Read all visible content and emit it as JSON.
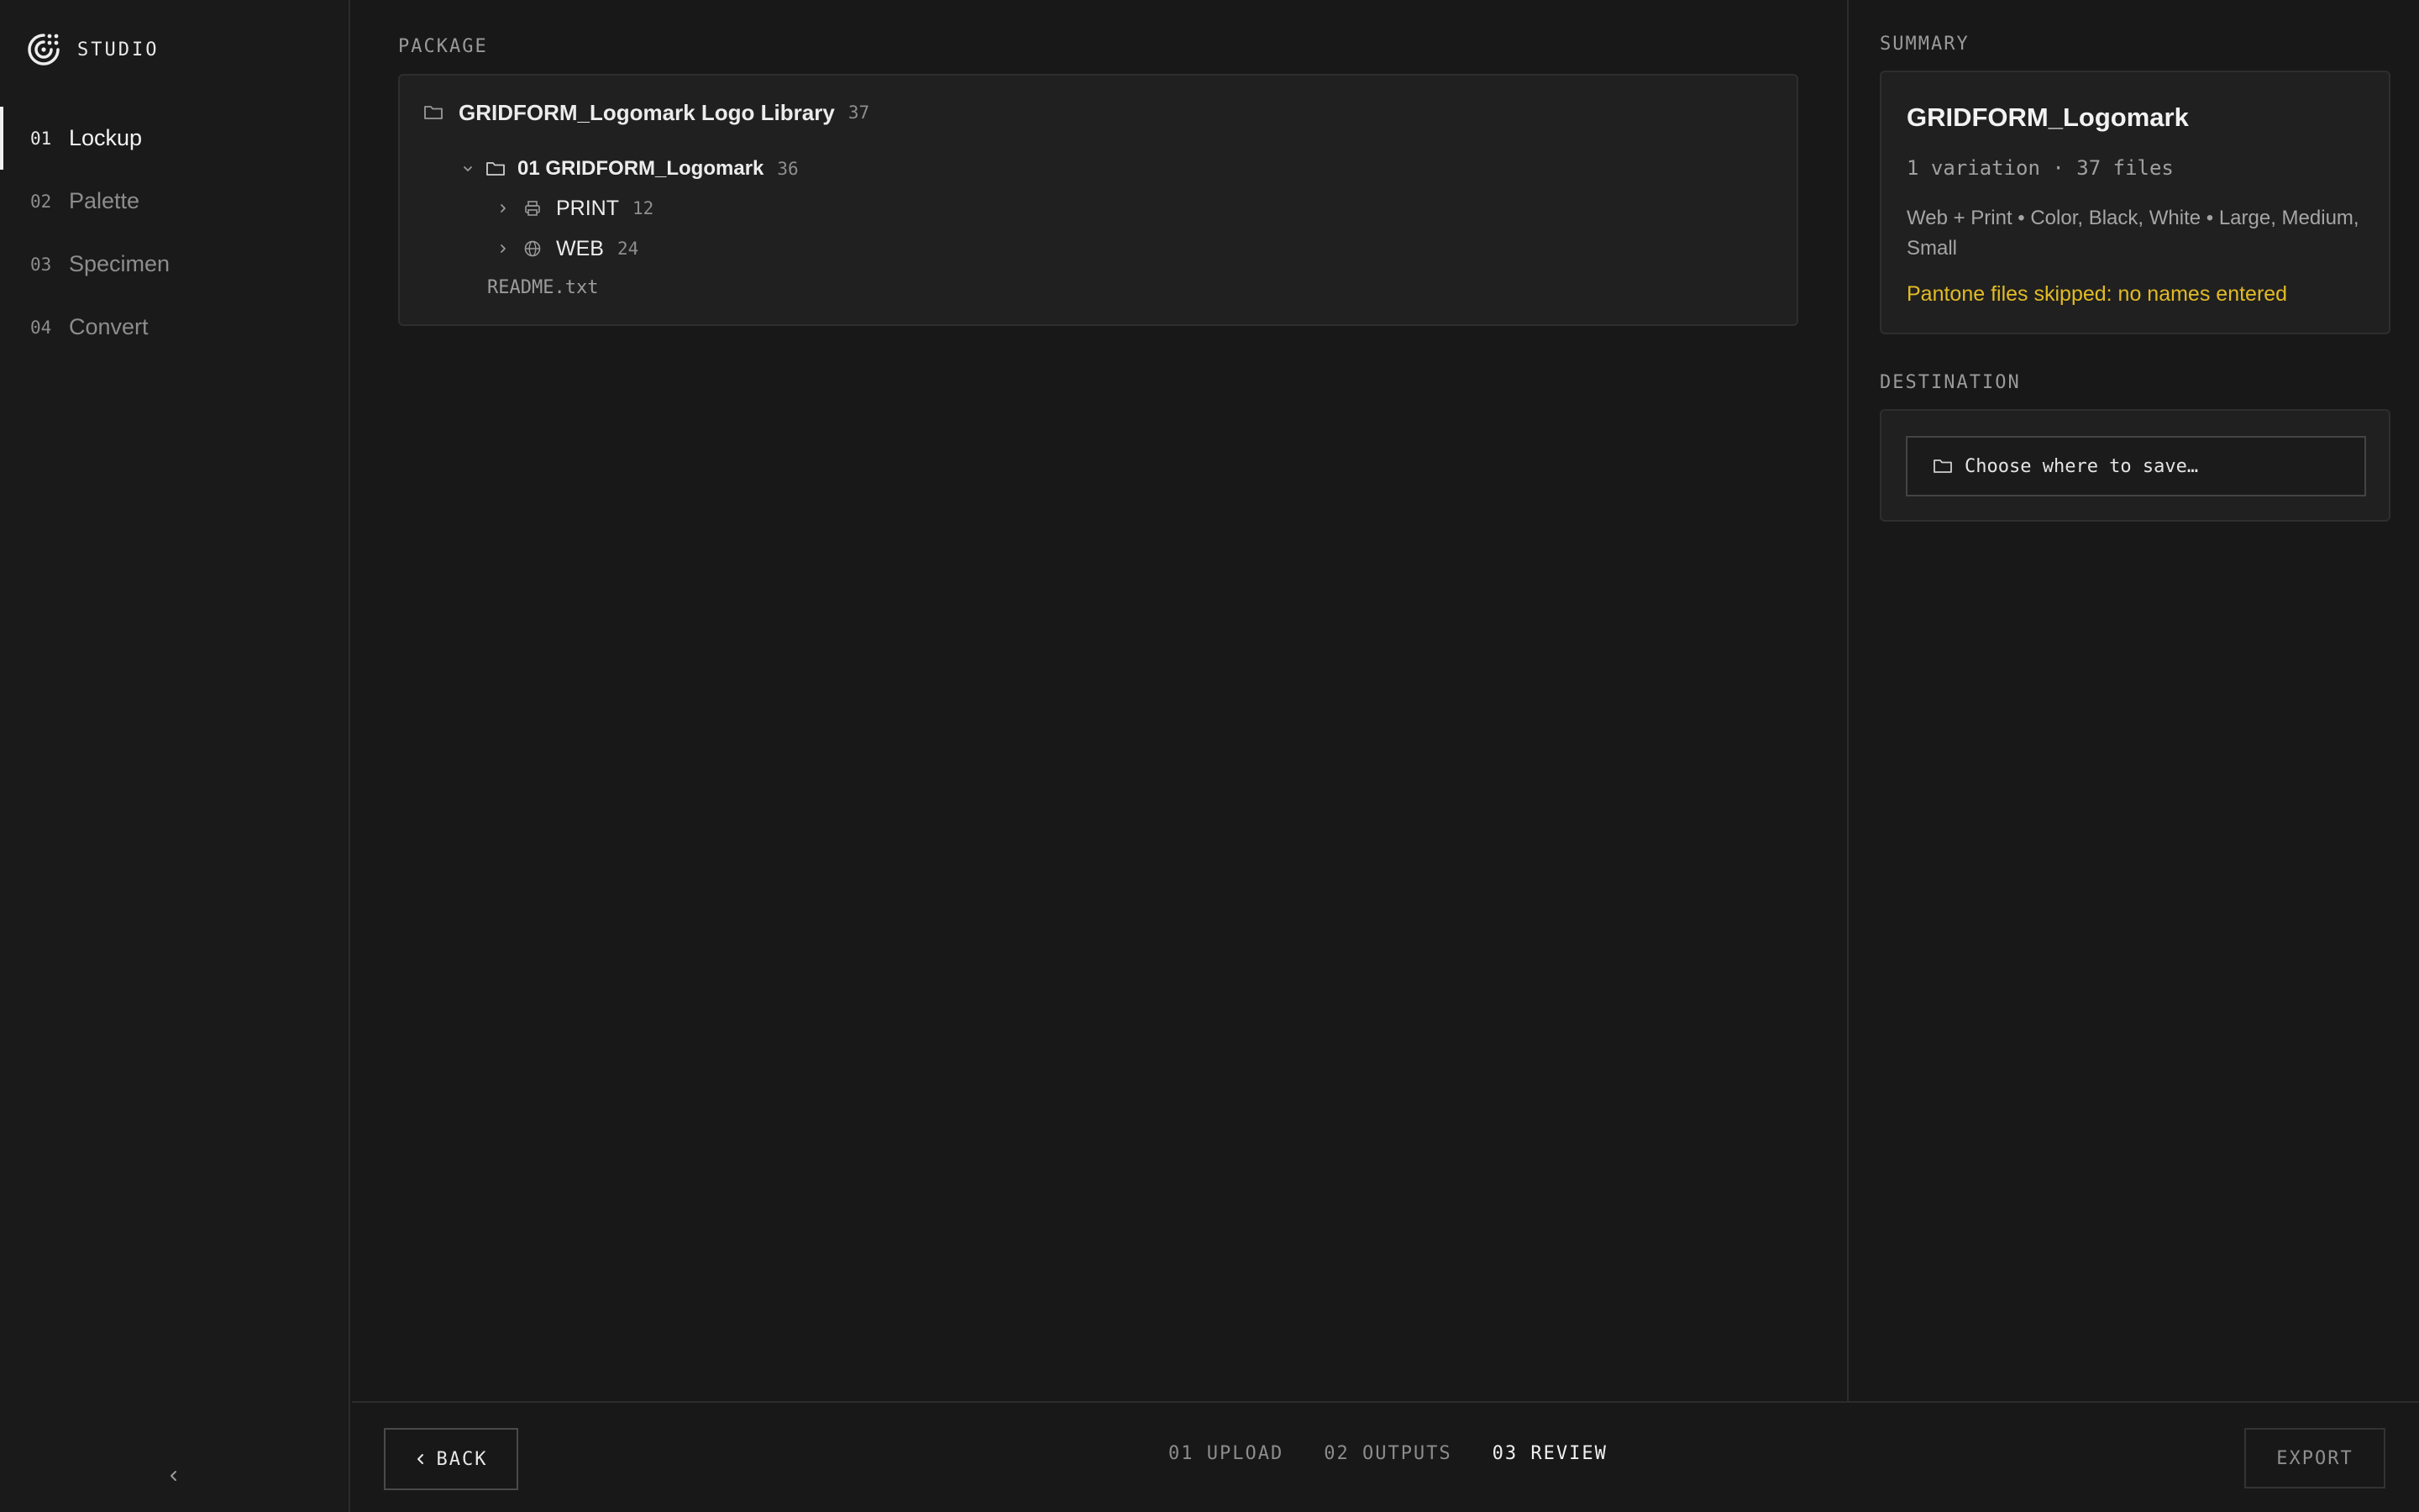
{
  "brand": {
    "name": "STUDIO",
    "logo_icon": "gridform-logo-icon"
  },
  "sidebar": {
    "items": [
      {
        "num": "01",
        "label": "Lockup",
        "active": true
      },
      {
        "num": "02",
        "label": "Palette",
        "active": false
      },
      {
        "num": "03",
        "label": "Specimen",
        "active": false
      },
      {
        "num": "04",
        "label": "Convert",
        "active": false
      }
    ],
    "collapse_icon": "chevron-left-icon"
  },
  "package": {
    "label": "PACKAGE",
    "root": {
      "name": "GRIDFORM_Logomark Logo Library",
      "count": "37",
      "icon": "folder-icon"
    },
    "variation": {
      "name": "01 GRIDFORM_Logomark",
      "count": "36",
      "icon": "folder-icon",
      "expanded": true
    },
    "print": {
      "name": "PRINT",
      "count": "12",
      "icon": "printer-icon"
    },
    "web": {
      "name": "WEB",
      "count": "24",
      "icon": "globe-icon"
    },
    "readme": {
      "name": "README.txt"
    }
  },
  "summary": {
    "label": "SUMMARY",
    "title": "GRIDFORM_Logomark",
    "meta": "1 variation · 37 files",
    "description": "Web + Print • Color, Black, White • Large, Medium, Small",
    "warning": "Pantone files skipped: no names entered",
    "warning_color": "#e2bb25"
  },
  "destination": {
    "label": "DESTINATION",
    "button_label": "Choose where to save…",
    "icon": "folder-icon"
  },
  "footer": {
    "back_label": "BACK",
    "steps": [
      {
        "label": "01 UPLOAD",
        "active": false
      },
      {
        "label": "02 OUTPUTS",
        "active": false
      },
      {
        "label": "03 REVIEW",
        "active": true
      }
    ],
    "export_label": "EXPORT"
  }
}
